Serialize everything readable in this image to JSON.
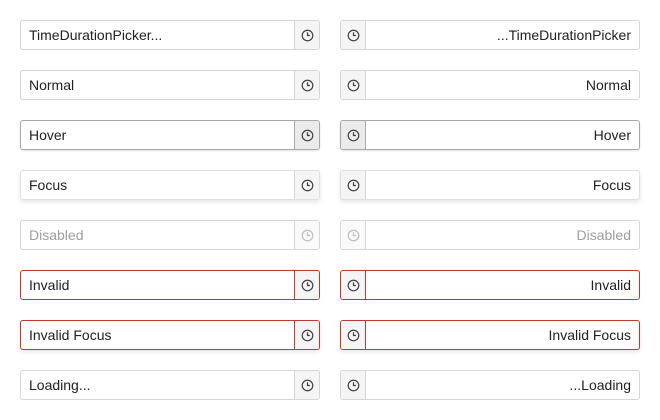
{
  "rows": [
    {
      "ltr": "TimeDurationPicker...",
      "rtl": "...TimeDurationPicker"
    },
    {
      "ltr": "Normal",
      "rtl": "Normal"
    },
    {
      "ltr": "Hover",
      "rtl": "Hover"
    },
    {
      "ltr": "Focus",
      "rtl": "Focus"
    },
    {
      "ltr": "Disabled",
      "rtl": "Disabled"
    },
    {
      "ltr": "Invalid",
      "rtl": "Invalid"
    },
    {
      "ltr": "Invalid Focus",
      "rtl": "Invalid Focus"
    },
    {
      "ltr": "Loading...",
      "rtl": "...Loading"
    }
  ],
  "icons": {
    "toggle": "clock-icon"
  },
  "colors": {
    "border": "#d6d6d6",
    "invalid_border": "#c0392b",
    "button_bg": "#f5f5f5",
    "disabled_text": "#9e9e9e"
  }
}
